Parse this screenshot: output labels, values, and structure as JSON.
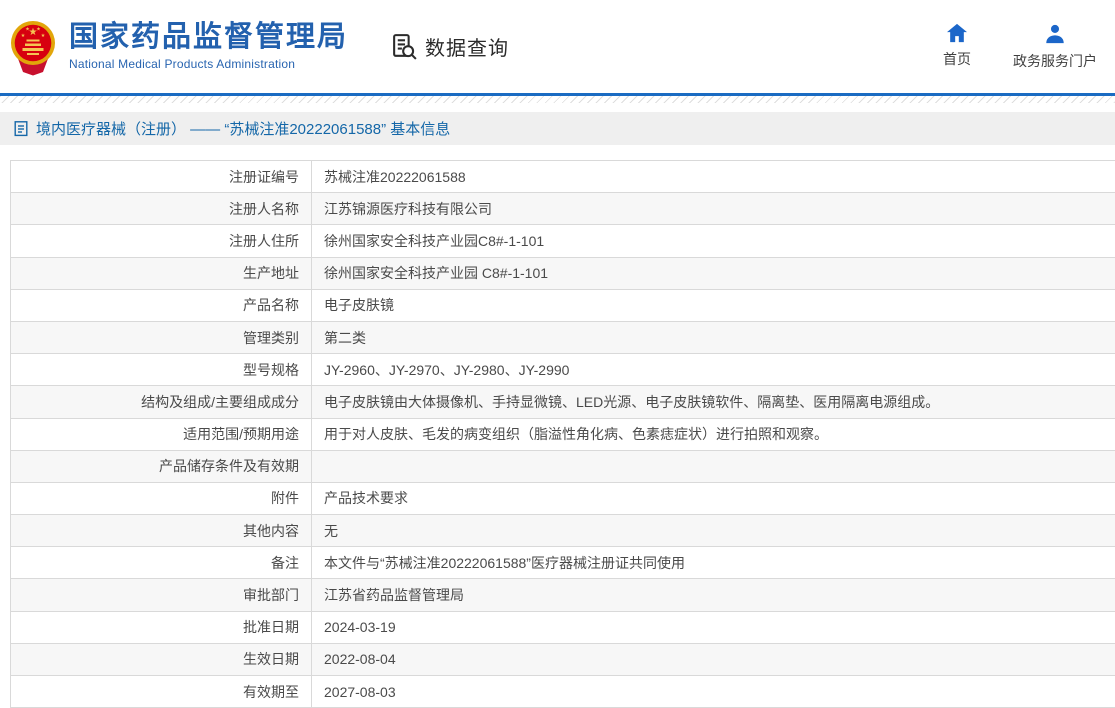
{
  "header": {
    "org_name_cn": "国家药品监督管理局",
    "org_name_en": "National Medical Products Administration",
    "nav_data_query": "数据查询",
    "nav_home": "首页",
    "nav_portal": "政务服务门户"
  },
  "icons": {
    "brand": "national-emblem",
    "data_query": "document-search-icon",
    "home": "home-icon",
    "portal": "person-icon",
    "breadcrumb": "document-icon"
  },
  "breadcrumb": {
    "text": "境内医疗器械（注册） —— “苏械注准20222061588” 基本信息"
  },
  "colors": {
    "brand_blue": "#2361ae",
    "icon_blue": "#1b66c9",
    "header_line_blue": "#1a6bc2",
    "breadcrumb_text_blue": "#1467a8",
    "breadcrumb_bg": "#efefef",
    "alt_row_bg": "#f7f7f7",
    "table_border": "#d9d9d9",
    "body_text": "#4a4a4a"
  },
  "table": {
    "rows": [
      {
        "label": "注册证编号",
        "value": "苏械注准20222061588"
      },
      {
        "label": "注册人名称",
        "value": "江苏锦源医疗科技有限公司"
      },
      {
        "label": "注册人住所",
        "value": "徐州国家安全科技产业园C8#-1-101"
      },
      {
        "label": "生产地址",
        "value": "徐州国家安全科技产业园 C8#-1-101"
      },
      {
        "label": "产品名称",
        "value": "电子皮肤镜"
      },
      {
        "label": "管理类别",
        "value": "第二类"
      },
      {
        "label": "型号规格",
        "value": "JY-2960、JY-2970、JY-2980、JY-2990"
      },
      {
        "label": "结构及组成/主要组成成分",
        "value": "电子皮肤镜由大体摄像机、手持显微镜、LED光源、电子皮肤镜软件、隔离垫、医用隔离电源组成。"
      },
      {
        "label": "适用范围/预期用途",
        "value": "用于对人皮肤、毛发的病变组织（脂溢性角化病、色素痣症状）进行拍照和观察。"
      },
      {
        "label": "产品储存条件及有效期",
        "value": ""
      },
      {
        "label": "附件",
        "value": "产品技术要求"
      },
      {
        "label": "其他内容",
        "value": "无"
      },
      {
        "label": "备注",
        "value": "本文件与“苏械注准20222061588”医疗器械注册证共同使用"
      },
      {
        "label": "审批部门",
        "value": "江苏省药品监督管理局"
      },
      {
        "label": "批准日期",
        "value": "2024-03-19"
      },
      {
        "label": "生效日期",
        "value": "2022-08-04"
      },
      {
        "label": "有效期至",
        "value": "2027-08-03"
      }
    ]
  }
}
